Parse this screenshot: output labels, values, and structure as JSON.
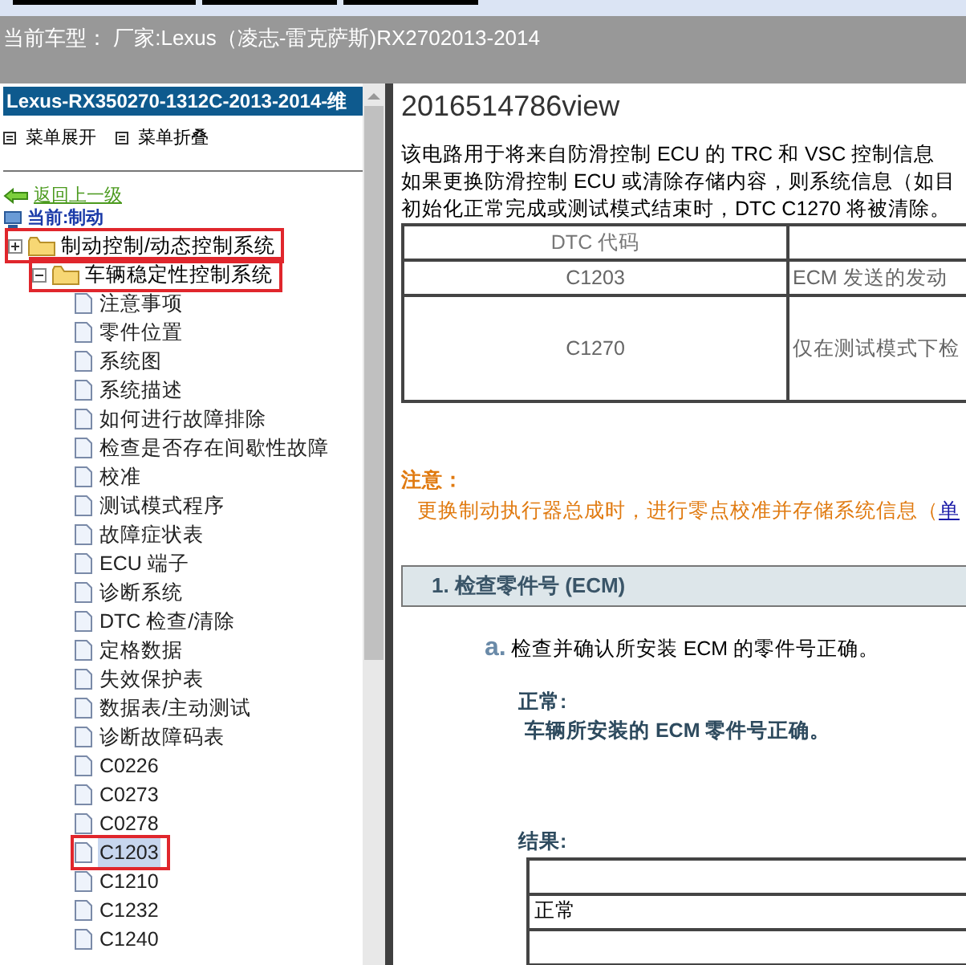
{
  "header": {
    "vehicle": "当前车型： 厂家:Lexus（凌志-雷克萨斯)RX2702013-2014"
  },
  "sidebar": {
    "title": "Lexus-RX350270-1312C-2013-2014-维",
    "menu_buttons": [
      "菜单展开",
      "菜单折叠"
    ],
    "back_link": "返回上一级",
    "current": "当前:制动",
    "tree": [
      {
        "label": "制动控制/动态控制系统",
        "expanded": false,
        "highlighted": true,
        "children": [
          {
            "label": "车辆稳定性控制系统",
            "expanded": true,
            "highlighted": true,
            "children": [
              {
                "label": "注意事项",
                "selected": false,
                "highlighted": false
              },
              {
                "label": "零件位置",
                "selected": false,
                "highlighted": false
              },
              {
                "label": "系统图",
                "selected": false,
                "highlighted": false
              },
              {
                "label": "系统描述",
                "selected": false,
                "highlighted": false
              },
              {
                "label": "如何进行故障排除",
                "selected": false,
                "highlighted": false
              },
              {
                "label": "检查是否存在间歇性故障",
                "selected": false,
                "highlighted": false
              },
              {
                "label": "校准",
                "selected": false,
                "highlighted": false
              },
              {
                "label": "测试模式程序",
                "selected": false,
                "highlighted": false
              },
              {
                "label": "故障症状表",
                "selected": false,
                "highlighted": false
              },
              {
                "label": "ECU 端子",
                "selected": false,
                "highlighted": false
              },
              {
                "label": "诊断系统",
                "selected": false,
                "highlighted": false
              },
              {
                "label": "DTC 检查/清除",
                "selected": false,
                "highlighted": false
              },
              {
                "label": "定格数据",
                "selected": false,
                "highlighted": false
              },
              {
                "label": "失效保护表",
                "selected": false,
                "highlighted": false
              },
              {
                "label": "数据表/主动测试",
                "selected": false,
                "highlighted": false
              },
              {
                "label": "诊断故障码表",
                "selected": false,
                "highlighted": false
              },
              {
                "label": "C0226",
                "selected": false,
                "highlighted": false
              },
              {
                "label": "C0273",
                "selected": false,
                "highlighted": false
              },
              {
                "label": "C0278",
                "selected": false,
                "highlighted": false
              },
              {
                "label": "C1203",
                "selected": true,
                "highlighted": true
              },
              {
                "label": "C1210",
                "selected": false,
                "highlighted": false
              },
              {
                "label": "C1232",
                "selected": false,
                "highlighted": false
              },
              {
                "label": "C1240",
                "selected": false,
                "highlighted": false
              }
            ]
          }
        ]
      }
    ]
  },
  "content": {
    "title": "2016514786view",
    "description": [
      "该电路用于将来自防滑控制 ECU 的 TRC 和 VSC 控制信息",
      "如果更换防滑控制 ECU 或清除存储内容，则系统信息（如目",
      "初始化正常完成或测试模式结束时，DTC C1270 将被清除。"
    ],
    "dtc_table": {
      "columns": [
        "DTC 代码",
        ""
      ],
      "rows": [
        [
          "C1203",
          "ECM 发送的发动"
        ],
        [
          "C1270",
          "仅在测试模式下检"
        ]
      ]
    },
    "note": {
      "title": "注意：",
      "text": "更换制动执行器总成时，进行零点校准并存储系统信息（",
      "link": "单"
    },
    "step": {
      "title": "1. 检查零件号 (ECM)",
      "substep_marker": "a.",
      "substep_text": "检查并确认所安装 ECM 的零件号正确。",
      "normal_label": "正常:",
      "normal_text": "车辆所安装的 ECM 零件号正确。",
      "result_label": "结果:",
      "result_rows": [
        "",
        "正常"
      ]
    }
  }
}
